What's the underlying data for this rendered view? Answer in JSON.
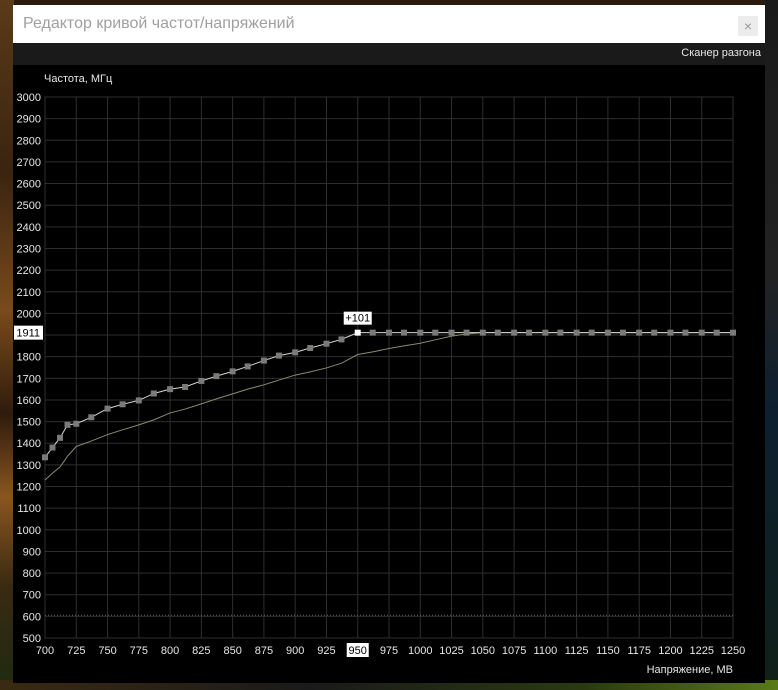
{
  "window": {
    "title": "Редактор кривой частот/напряжений",
    "close_glyph": "×"
  },
  "toolbar": {
    "scanner_label": "Сканер разгона"
  },
  "chart_data": {
    "type": "line",
    "ylabel": "Частота, МГц",
    "xlabel": "Напряжение, МВ",
    "xlim": [
      700,
      1250
    ],
    "ylim": [
      500,
      3000
    ],
    "x_ticks": [
      700,
      725,
      750,
      775,
      800,
      825,
      850,
      875,
      900,
      925,
      950,
      975,
      1000,
      1025,
      1050,
      1075,
      1100,
      1125,
      1150,
      1175,
      1200,
      1225,
      1250
    ],
    "y_ticks": [
      500,
      600,
      700,
      800,
      900,
      1000,
      1100,
      1200,
      1300,
      1400,
      1500,
      1600,
      1700,
      1800,
      1900,
      2000,
      2100,
      2200,
      2300,
      2400,
      2500,
      2600,
      2700,
      2800,
      2900,
      3000
    ],
    "grid": true,
    "reference_line": 605,
    "selected_point": {
      "x": 950,
      "y": 1911,
      "offset_label": "+101"
    },
    "y_marker_label": "1911",
    "x_marker_label": "950",
    "series": [
      {
        "role": "edited-curve",
        "color": "#d8d8c8",
        "points": [
          [
            700,
            1335
          ],
          [
            706,
            1380
          ],
          [
            712,
            1425
          ],
          [
            718,
            1485
          ],
          [
            725,
            1490
          ],
          [
            737,
            1520
          ],
          [
            750,
            1560
          ],
          [
            762,
            1580
          ],
          [
            775,
            1598
          ],
          [
            787,
            1630
          ],
          [
            800,
            1650
          ],
          [
            812,
            1660
          ],
          [
            825,
            1688
          ],
          [
            837,
            1710
          ],
          [
            850,
            1732
          ],
          [
            862,
            1755
          ],
          [
            875,
            1782
          ],
          [
            887,
            1805
          ],
          [
            900,
            1820
          ],
          [
            912,
            1840
          ],
          [
            925,
            1860
          ],
          [
            937,
            1880
          ],
          [
            950,
            1911
          ],
          [
            962,
            1911
          ],
          [
            975,
            1911
          ],
          [
            987,
            1911
          ],
          [
            1000,
            1911
          ],
          [
            1012,
            1911
          ],
          [
            1025,
            1911
          ],
          [
            1037,
            1911
          ],
          [
            1050,
            1911
          ],
          [
            1062,
            1911
          ],
          [
            1075,
            1911
          ],
          [
            1087,
            1911
          ],
          [
            1100,
            1911
          ],
          [
            1112,
            1911
          ],
          [
            1125,
            1911
          ],
          [
            1137,
            1911
          ],
          [
            1150,
            1911
          ],
          [
            1162,
            1911
          ],
          [
            1175,
            1911
          ],
          [
            1187,
            1911
          ],
          [
            1200,
            1911
          ],
          [
            1212,
            1911
          ],
          [
            1225,
            1911
          ],
          [
            1237,
            1911
          ],
          [
            1250,
            1911
          ]
        ]
      },
      {
        "role": "default-curve",
        "color": "#8a8a70",
        "points": [
          [
            700,
            1230
          ],
          [
            706,
            1262
          ],
          [
            712,
            1290
          ],
          [
            718,
            1340
          ],
          [
            725,
            1385
          ],
          [
            737,
            1410
          ],
          [
            750,
            1440
          ],
          [
            762,
            1462
          ],
          [
            775,
            1485
          ],
          [
            787,
            1508
          ],
          [
            800,
            1540
          ],
          [
            812,
            1558
          ],
          [
            825,
            1582
          ],
          [
            837,
            1605
          ],
          [
            850,
            1628
          ],
          [
            862,
            1650
          ],
          [
            875,
            1670
          ],
          [
            887,
            1692
          ],
          [
            900,
            1715
          ],
          [
            912,
            1730
          ],
          [
            925,
            1748
          ],
          [
            937,
            1770
          ],
          [
            950,
            1810
          ],
          [
            962,
            1822
          ],
          [
            975,
            1838
          ],
          [
            987,
            1850
          ],
          [
            1000,
            1862
          ],
          [
            1012,
            1878
          ],
          [
            1025,
            1895
          ],
          [
            1037,
            1905
          ],
          [
            1050,
            1911
          ],
          [
            1062,
            1911
          ],
          [
            1075,
            1911
          ],
          [
            1087,
            1911
          ],
          [
            1100,
            1911
          ],
          [
            1112,
            1911
          ],
          [
            1125,
            1911
          ],
          [
            1137,
            1911
          ],
          [
            1150,
            1911
          ],
          [
            1162,
            1911
          ],
          [
            1175,
            1911
          ],
          [
            1187,
            1911
          ],
          [
            1200,
            1911
          ],
          [
            1212,
            1911
          ],
          [
            1225,
            1911
          ],
          [
            1237,
            1911
          ],
          [
            1250,
            1911
          ]
        ]
      }
    ]
  }
}
